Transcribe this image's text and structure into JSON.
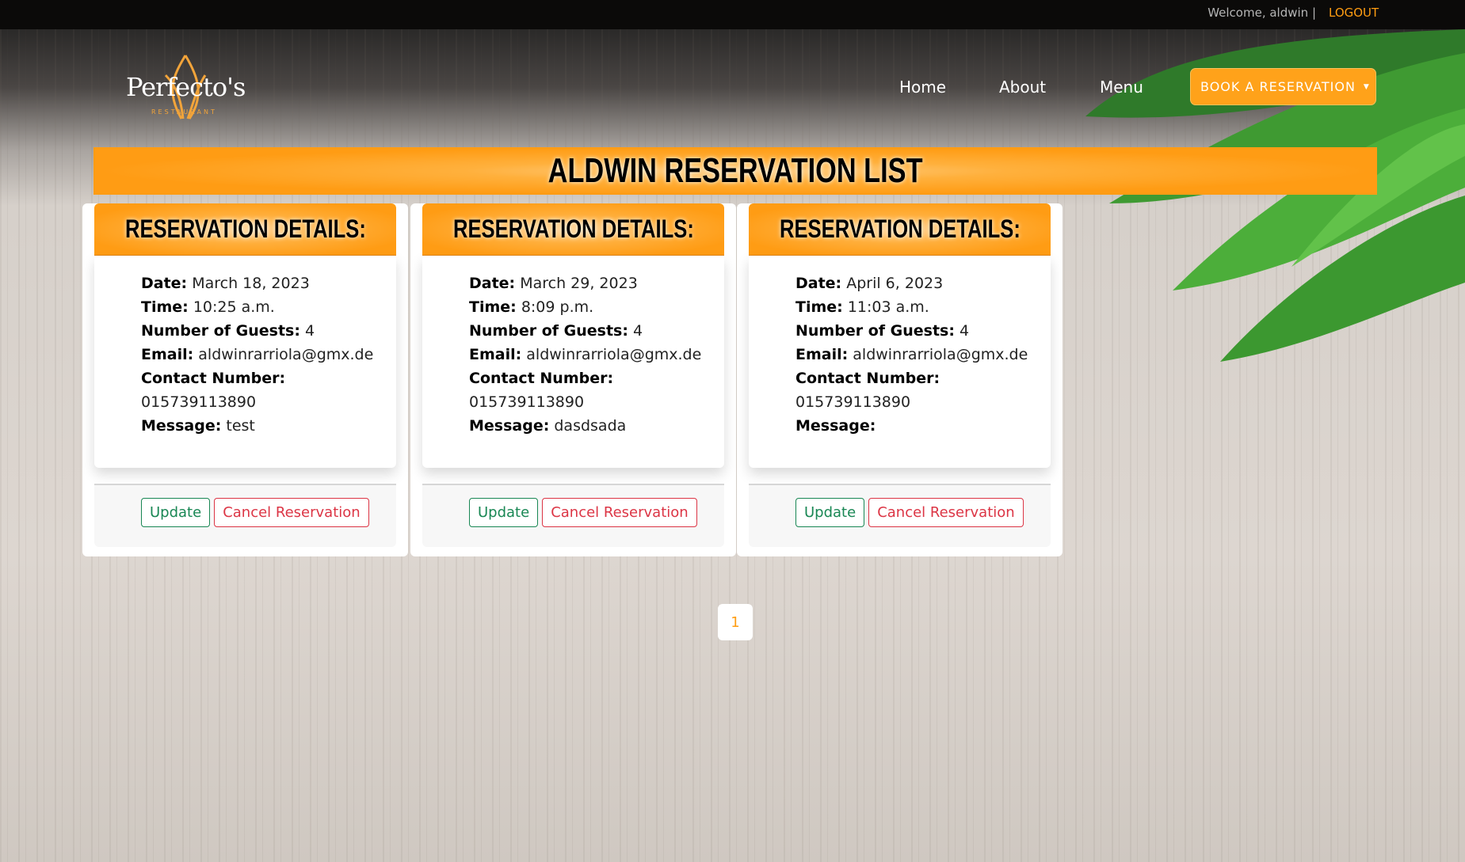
{
  "topbar": {
    "welcome": "Welcome, aldwin |",
    "logout": "LOGOUT"
  },
  "logo": {
    "name": "Perfecto's",
    "sub": "RESTAURANT"
  },
  "nav": {
    "home": "Home",
    "about": "About",
    "menu": "Menu",
    "book": "BOOK A RESERVATION"
  },
  "title": "ALDWIN RESERVATION LIST",
  "labels": {
    "header": "RESERVATION DETAILS:",
    "date": "Date:",
    "time": "Time:",
    "guests": "Number of Guests:",
    "email": "Email:",
    "contact": "Contact Number:",
    "message": "Message:",
    "update": "Update",
    "cancel": "Cancel Reservation"
  },
  "reservations": [
    {
      "date": "March 18, 2023",
      "time": "10:25 a.m.",
      "guests": "4",
      "email": "aldwinrarriola@gmx.de",
      "contact": "015739113890",
      "message": "test"
    },
    {
      "date": "March 29, 2023",
      "time": "8:09 p.m.",
      "guests": "4",
      "email": "aldwinrarriola@gmx.de",
      "contact": "015739113890",
      "message": "dasdsada"
    },
    {
      "date": "April 6, 2023",
      "time": "11:03 a.m.",
      "guests": "4",
      "email": "aldwinrarriola@gmx.de",
      "contact": "015739113890",
      "message": ""
    }
  ],
  "pagination": {
    "current": "1"
  },
  "colors": {
    "accent": "#ff9d12",
    "update": "#198754",
    "cancel": "#dc3545"
  }
}
